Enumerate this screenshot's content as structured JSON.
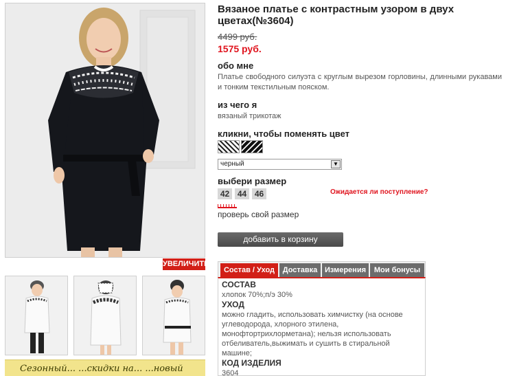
{
  "product": {
    "title": "Вязаное платье с контрастным узором в двух цветах(№3604)",
    "price_old": "4499 руб.",
    "price_new": "1575 руб."
  },
  "about": {
    "heading": "обо мне",
    "text": "Платье свободного силуэта с круглым вырезом горловины, длинными рукавами и тонким текстильным пояском."
  },
  "material": {
    "heading": "из чего я",
    "text": "вязаный трикотаж"
  },
  "color": {
    "heading": "кликни, чтобы поменять цвет",
    "selected": "черный",
    "arrow": "▼"
  },
  "size": {
    "heading": "выбери размер",
    "options": [
      "42",
      "44",
      "46"
    ],
    "expect_link": "Ожидается ли поступление?",
    "check_link": "проверь свой размер"
  },
  "cart": {
    "label": "добавить в корзину"
  },
  "gallery": {
    "zoom_label": "УВЕЛИЧИТЬ"
  },
  "banner": {
    "text": "Сезонный...  ...скидки на...  ...новый"
  },
  "tabs": [
    "Состав / Уход",
    "Доставка",
    "Измерения",
    "Мои бонусы"
  ],
  "tab_content": {
    "composition_h": "СОСТАВ",
    "composition": "хлопок 70%;п/э 30%",
    "care_h": "УХОД",
    "care": "можно гладить, использовать химчистку (на основе углеводорода, хлорного этилена, монофтортрихлорметана); нельзя использовать отбеливатель,выжимать и сушить в стиральной машине;",
    "code_h": "КОД ИЗДЕЛИЯ",
    "code": "3604"
  },
  "colors": {
    "accent": "#d21f17",
    "price": "#e0141e",
    "tab": "#6c6c6c"
  }
}
